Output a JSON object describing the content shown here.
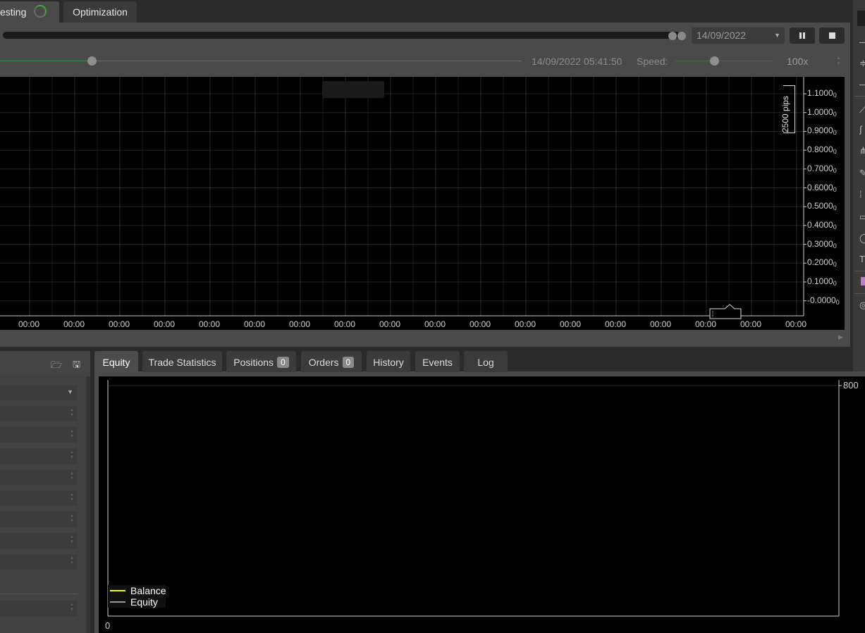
{
  "top_tabs": [
    {
      "label": "esting",
      "active": true
    },
    {
      "label": "Optimization",
      "active": false
    }
  ],
  "controls": {
    "date": "14/09/2022",
    "sim_time": "14/09/2022 05:41:50",
    "speed_label": "Speed:",
    "speed_value": "100x"
  },
  "main_chart": {
    "y_labels": [
      "1.1000",
      "1.0000",
      "0.9000",
      "0.8000",
      "0.7000",
      "0.6000",
      "0.5000",
      "0.4000",
      "0.3000",
      "0.2000",
      "0.1000",
      "-0.0000"
    ],
    "y_label_suffix": "0",
    "x_labels": [
      "00:00",
      "00:00",
      "00:00",
      "00:00",
      "00:00",
      "00:00",
      "00:00",
      "00:00",
      "00:00",
      "00:00",
      "00:00",
      "00:00",
      "00:00",
      "00:00",
      "00:00",
      "00:00",
      "00:00",
      "00:00"
    ],
    "ruler_label": "2500 pips"
  },
  "bottom_tabs": [
    {
      "label": "Equity",
      "active": true,
      "badge": null
    },
    {
      "label": "Trade Statistics",
      "active": false,
      "badge": null
    },
    {
      "label": "Positions",
      "active": false,
      "badge": "0"
    },
    {
      "label": "Orders",
      "active": false,
      "badge": "0"
    },
    {
      "label": "History",
      "active": false,
      "badge": null
    },
    {
      "label": "Events",
      "active": false,
      "badge": null
    },
    {
      "label": "Log",
      "active": false,
      "badge": null
    }
  ],
  "equity_chart": {
    "y_tick": "800",
    "x_tick": "0",
    "legend": [
      {
        "name": "Balance",
        "color": "#ffff00"
      },
      {
        "name": "Equity",
        "color": "#9a9a9a"
      }
    ]
  },
  "colors": {
    "accent_green": "#43a047",
    "balance_line": "#ffff00",
    "equity_line": "#9a9a9a"
  },
  "icons": [
    "spinner-icon",
    "dropdown-arrow-icon",
    "pause-icon",
    "stop-icon",
    "folder-icon",
    "save-icon",
    "scroll-right-icon"
  ]
}
